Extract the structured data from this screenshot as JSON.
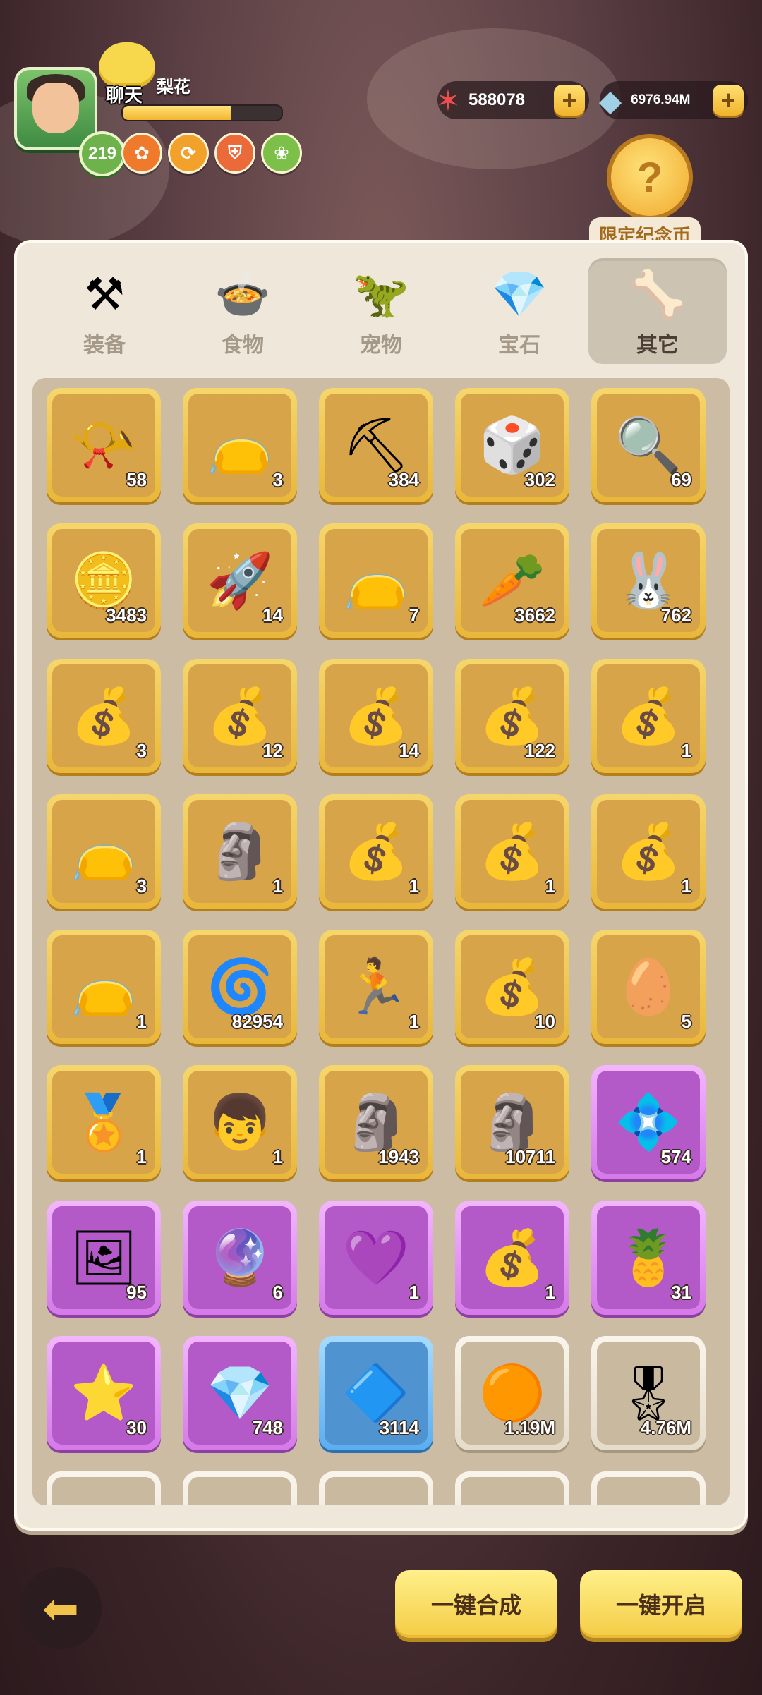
{
  "player": {
    "chat_label": "聊天",
    "name": "梨花",
    "level": "219",
    "xp_fraction": 0.68,
    "buffs": [
      {
        "icon": "flower-buff-icon",
        "color": "#f07a2b",
        "glyph": "✿"
      },
      {
        "icon": "swirl-buff-icon",
        "color": "#f2a12b",
        "glyph": "⟳"
      },
      {
        "icon": "shield-buff-icon",
        "color": "#ea6a3a",
        "glyph": "⛨"
      },
      {
        "icon": "fruit-buff-icon",
        "color": "#7cc04a",
        "glyph": "❀"
      }
    ]
  },
  "currency": {
    "starfish_amount": "588078",
    "shell_amount": "6976.94M"
  },
  "event": {
    "coin_label": "限定纪念币"
  },
  "tabs": [
    {
      "label": "装备",
      "icon": "hammer-icon",
      "glyph": "⚒"
    },
    {
      "label": "食物",
      "icon": "food-bowl-icon",
      "glyph": "🍲"
    },
    {
      "label": "宠物",
      "icon": "pet-fossil-icon",
      "glyph": "🦖"
    },
    {
      "label": "宝石",
      "icon": "gem-icon",
      "glyph": "💎"
    },
    {
      "label": "其它",
      "icon": "bone-icon",
      "glyph": "🦴"
    }
  ],
  "items": [
    {
      "icon": "horn-scroll-icon",
      "glyph": "📯",
      "count": "58",
      "rarity": "gold"
    },
    {
      "icon": "purple-bag-icon",
      "glyph": "👝",
      "count": "3",
      "rarity": "gold"
    },
    {
      "icon": "pickaxe-icon",
      "glyph": "⛏",
      "count": "384",
      "rarity": "gold"
    },
    {
      "icon": "dice-icon",
      "glyph": "🎲",
      "count": "302",
      "rarity": "gold"
    },
    {
      "icon": "magnifier-icon",
      "glyph": "🔍",
      "count": "69",
      "rarity": "gold"
    },
    {
      "icon": "cake-coin-icon",
      "glyph": "🪙",
      "count": "3483",
      "rarity": "gold"
    },
    {
      "icon": "rocket-card-icon",
      "glyph": "🚀",
      "count": "14",
      "rarity": "gold"
    },
    {
      "icon": "purple-bag-icon",
      "glyph": "👝",
      "count": "7",
      "rarity": "gold"
    },
    {
      "icon": "carrot-bag-icon",
      "glyph": "🥕",
      "count": "3662",
      "rarity": "gold"
    },
    {
      "icon": "pet-bag-icon",
      "glyph": "🐰",
      "count": "762",
      "rarity": "gold"
    },
    {
      "icon": "gem-bag-icon",
      "glyph": "💰",
      "count": "3",
      "rarity": "gold"
    },
    {
      "icon": "gem-bag-icon",
      "glyph": "💰",
      "count": "12",
      "rarity": "gold"
    },
    {
      "icon": "gem-bag-icon",
      "glyph": "💰",
      "count": "14",
      "rarity": "gold"
    },
    {
      "icon": "gem-bag-icon",
      "glyph": "💰",
      "count": "122",
      "rarity": "gold"
    },
    {
      "icon": "gem-bag-icon",
      "glyph": "💰",
      "count": "1",
      "rarity": "gold"
    },
    {
      "icon": "purple-bag-icon",
      "glyph": "👝",
      "count": "3",
      "rarity": "gold"
    },
    {
      "icon": "stone-tablet-icon",
      "glyph": "🗿",
      "count": "1",
      "rarity": "gold"
    },
    {
      "icon": "gem-bag-icon",
      "glyph": "💰",
      "count": "1",
      "rarity": "gold"
    },
    {
      "icon": "crystal-bag-icon",
      "glyph": "💰",
      "count": "1",
      "rarity": "gold"
    },
    {
      "icon": "crystal-bag-icon",
      "glyph": "💰",
      "count": "1",
      "rarity": "gold"
    },
    {
      "icon": "purple-bag-icon",
      "glyph": "👝",
      "count": "1",
      "rarity": "gold"
    },
    {
      "icon": "spiral-coin-icon",
      "glyph": "🌀",
      "count": "82954",
      "rarity": "gold"
    },
    {
      "icon": "skill-orb-icon",
      "glyph": "🏃",
      "count": "1",
      "rarity": "gold"
    },
    {
      "icon": "gem-bag-icon",
      "glyph": "💰",
      "count": "10",
      "rarity": "gold"
    },
    {
      "icon": "amber-icon",
      "glyph": "🥚",
      "count": "5",
      "rarity": "gold"
    },
    {
      "icon": "medal-icon",
      "glyph": "🏅",
      "count": "1",
      "rarity": "gold"
    },
    {
      "icon": "portrait-icon",
      "glyph": "👦",
      "count": "1",
      "rarity": "gold"
    },
    {
      "icon": "green-totem-icon",
      "glyph": "🗿",
      "count": "1943",
      "rarity": "gold"
    },
    {
      "icon": "stone-statue-icon",
      "glyph": "🗿",
      "count": "10711",
      "rarity": "gold"
    },
    {
      "icon": "crystal-cluster-icon",
      "glyph": "💠",
      "count": "574",
      "rarity": "purple"
    },
    {
      "icon": "portrait-card-icon",
      "glyph": "🖼",
      "count": "95",
      "rarity": "purple"
    },
    {
      "icon": "purple-crystal-icon",
      "glyph": "🔮",
      "count": "6",
      "rarity": "purple"
    },
    {
      "icon": "purple-gem-icon",
      "glyph": "💜",
      "count": "1",
      "rarity": "purple"
    },
    {
      "icon": "crystal-bag-icon",
      "glyph": "💰",
      "count": "1",
      "rarity": "purple"
    },
    {
      "icon": "rainbow-fruit-icon",
      "glyph": "🍍",
      "count": "31",
      "rarity": "purple"
    },
    {
      "icon": "star-badge-icon",
      "glyph": "⭐",
      "count": "30",
      "rarity": "purple"
    },
    {
      "icon": "pink-crystal-icon",
      "glyph": "💎",
      "count": "748",
      "rarity": "purple"
    },
    {
      "icon": "blue-crystal-icon",
      "glyph": "🔷",
      "count": "3114",
      "rarity": "blue"
    },
    {
      "icon": "orange-coin-icon",
      "glyph": "🟠",
      "count": "1.19M",
      "rarity": "white"
    },
    {
      "icon": "ribbon-medal-icon",
      "glyph": "🎖",
      "count": "4.76M",
      "rarity": "white"
    },
    {
      "icon": "partial-item-icon",
      "glyph": "",
      "count": "",
      "rarity": "white"
    },
    {
      "icon": "partial-item-icon",
      "glyph": "",
      "count": "",
      "rarity": "white"
    },
    {
      "icon": "partial-item-icon",
      "glyph": "",
      "count": "",
      "rarity": "white"
    },
    {
      "icon": "partial-item-icon",
      "glyph": "",
      "count": "",
      "rarity": "white"
    },
    {
      "icon": "partial-item-icon",
      "glyph": "",
      "count": "",
      "rarity": "white"
    }
  ],
  "actions": {
    "merge_all": "一键合成",
    "open_all": "一键开启"
  }
}
